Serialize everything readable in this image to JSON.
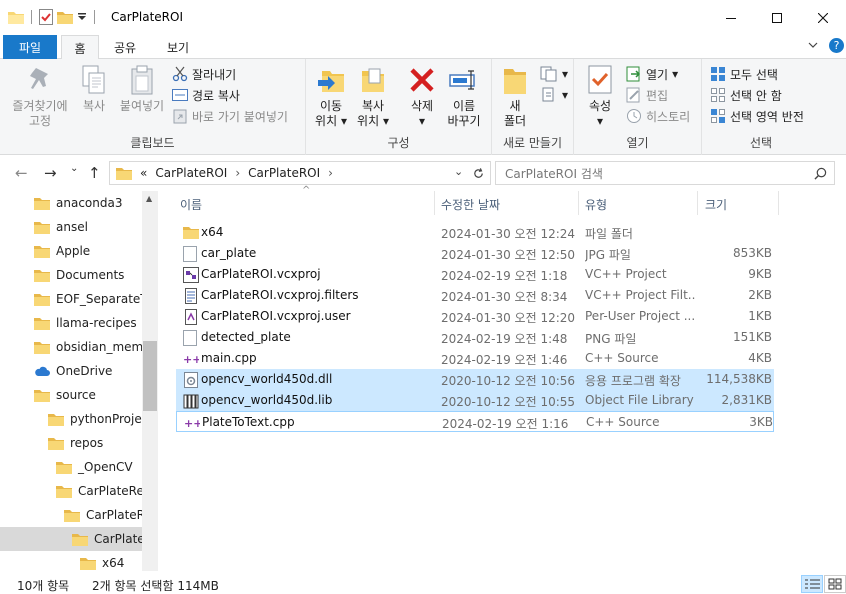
{
  "window": {
    "title": "CarPlateROI"
  },
  "tabs": [
    {
      "label": "파일"
    },
    {
      "label": "홈"
    },
    {
      "label": "공유"
    },
    {
      "label": "보기"
    }
  ],
  "ribbon": {
    "clipboard": {
      "group_label": "클립보드",
      "pin_label_1": "즐겨찾기에",
      "pin_label_2": "고정",
      "copy_label": "복사",
      "paste_label": "붙여넣기",
      "cut_label": "잘라내기",
      "copy_path_label": "경로 복사",
      "paste_shortcut_label": "바로 가기 붙여넣기"
    },
    "organize": {
      "group_label": "구성",
      "move_label_1": "이동",
      "move_label_2": "위치",
      "copy_to_label_1": "복사",
      "copy_to_label_2": "위치",
      "delete_label": "삭제",
      "rename_label_1": "이름",
      "rename_label_2": "바꾸기"
    },
    "new": {
      "group_label": "새로 만들기",
      "new_folder_label_1": "새",
      "new_folder_label_2": "폴더"
    },
    "open": {
      "group_label": "열기",
      "properties_label": "속성",
      "open_label": "열기",
      "edit_label": "편집",
      "history_label": "히스토리"
    },
    "select": {
      "group_label": "선택",
      "select_all_label": "모두 선택",
      "select_none_label": "선택 안 함",
      "invert_label": "선택 영역 반전"
    }
  },
  "address": {
    "overflow": "«",
    "crumbs": [
      "CarPlateROI",
      "CarPlateROI"
    ],
    "search_placeholder": "CarPlateROI 검색"
  },
  "nav_items": [
    {
      "label": "anaconda3",
      "icon": "folder"
    },
    {
      "label": "ansel",
      "icon": "folder"
    },
    {
      "label": "Apple",
      "icon": "folder"
    },
    {
      "label": "Documents",
      "icon": "folder"
    },
    {
      "label": "EOF_SeparateTra",
      "icon": "folder"
    },
    {
      "label": "llama-recipes",
      "icon": "folder"
    },
    {
      "label": "obsidian_memo",
      "icon": "folder"
    },
    {
      "label": "OneDrive",
      "icon": "cloud"
    },
    {
      "label": "source",
      "icon": "folder"
    },
    {
      "label": "pythonProject",
      "icon": "folder"
    },
    {
      "label": "repos",
      "icon": "folder"
    },
    {
      "label": "_OpenCV",
      "icon": "folder"
    },
    {
      "label": "CarPlateRead",
      "icon": "folder"
    },
    {
      "label": "CarPlateROI",
      "icon": "folder"
    },
    {
      "label": "CarPlateRO",
      "icon": "folder"
    },
    {
      "label": "x64",
      "icon": "folder"
    }
  ],
  "columns": {
    "name": "이름",
    "date": "수정한 날짜",
    "type": "유형",
    "size": "크기"
  },
  "files": [
    {
      "name": "x64",
      "date": "2024-01-30 오전 12:24",
      "type": "파일 폴더",
      "size": "",
      "icon": "folder"
    },
    {
      "name": "car_plate",
      "date": "2024-01-30 오전 12:50",
      "type": "JPG 파일",
      "size": "853KB",
      "icon": "image"
    },
    {
      "name": "CarPlateROI.vcxproj",
      "date": "2024-02-19 오전 1:18",
      "type": "VC++ Project",
      "size": "9KB",
      "icon": "vcxproj"
    },
    {
      "name": "CarPlateROI.vcxproj.filters",
      "date": "2024-01-30 오전 8:34",
      "type": "VC++ Project Filt...",
      "size": "2KB",
      "icon": "filters"
    },
    {
      "name": "CarPlateROI.vcxproj.user",
      "date": "2024-01-30 오전 12:20",
      "type": "Per-User Project ...",
      "size": "1KB",
      "icon": "user"
    },
    {
      "name": "detected_plate",
      "date": "2024-02-19 오전 1:48",
      "type": "PNG 파일",
      "size": "151KB",
      "icon": "image"
    },
    {
      "name": "main.cpp",
      "date": "2024-02-19 오전 1:46",
      "type": "C++ Source",
      "size": "4KB",
      "icon": "cpp"
    },
    {
      "name": "opencv_world450d.dll",
      "date": "2020-10-12 오전 10:56",
      "type": "응용 프로그램 확장",
      "size": "114,538KB",
      "icon": "dll"
    },
    {
      "name": "opencv_world450d.lib",
      "date": "2020-10-12 오전 10:55",
      "type": "Object File Library",
      "size": "2,831KB",
      "icon": "lib"
    },
    {
      "name": "PlateToText.cpp",
      "date": "2024-02-19 오전 1:16",
      "type": "C++ Source",
      "size": "3KB",
      "icon": "cpp"
    }
  ],
  "status": {
    "count": "10개 항목",
    "selection": "2개 항목 선택함 114MB"
  }
}
